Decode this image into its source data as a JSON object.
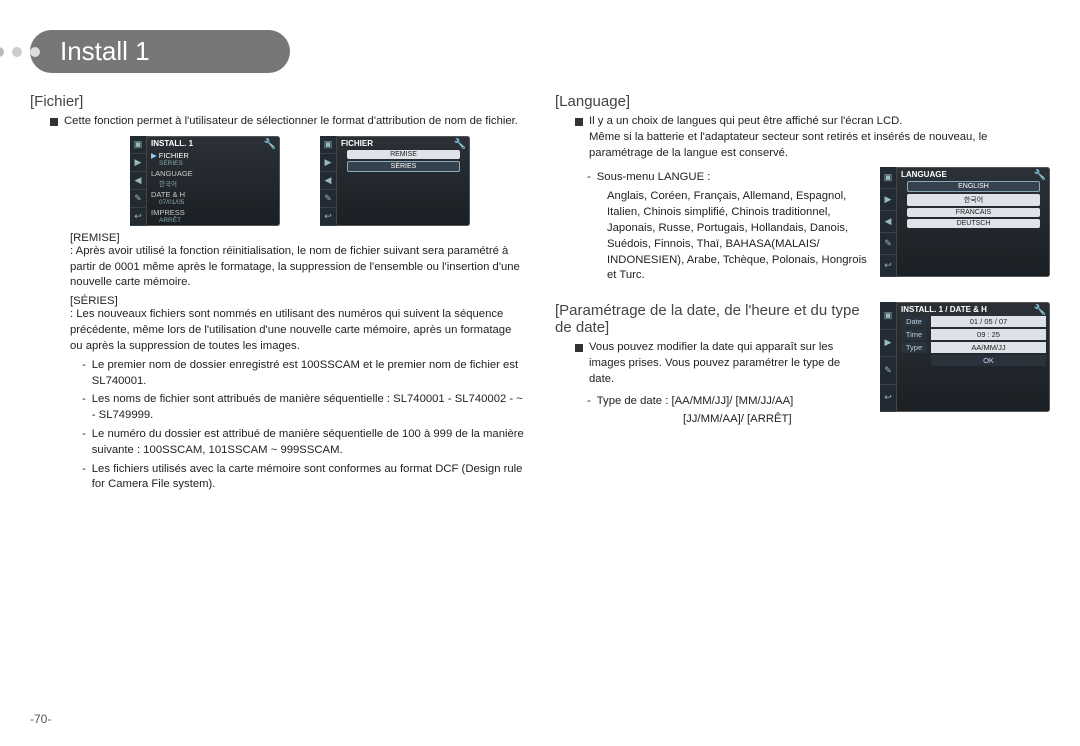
{
  "page_number": "-70-",
  "title": "Install 1",
  "left": {
    "heading": "[Fichier]",
    "intro": "Cette fonction permet à l'utilisateur de sélectionner le format d'attribution de nom de fichier.",
    "lcd1": {
      "header": "INSTALL. 1",
      "rows": [
        {
          "label": "FICHIER",
          "sub": "SÉRIES",
          "sel": true
        },
        {
          "label": "LANGUAGE",
          "sub": "한국어"
        },
        {
          "label": "DATE & H",
          "sub": "07/01/05"
        },
        {
          "label": "IMPRESS",
          "sub": "ARRÊT"
        }
      ]
    },
    "lcd2": {
      "header": "FICHIER",
      "pills": [
        "REMISE",
        "SÉRIES"
      ],
      "selected": 1
    },
    "remise_label": "[REMISE]",
    "remise_text": ": Après avoir utilisé la fonction réinitialisation, le nom de fichier suivant sera paramétré à partir de 0001 même après le formatage, la suppression de l'ensemble ou l'insertion d'une nouvelle carte mémoire.",
    "series_label": "[SÉRIES]",
    "series_text": ": Les nouveaux fichiers sont nommés en utilisant des numéros qui suivent la séquence précédente, même lors de l'utilisation d'une nouvelle carte mémoire, après un formatage ou après la suppression de toutes les images.",
    "bullets": [
      "Le premier nom de dossier enregistré est 100SSCAM et le premier nom de fichier est SL740001.",
      "Les noms de fichier sont attribués de manière séquentielle : SL740001 - SL740002 - ~ - SL749999.",
      "Le numéro du dossier est attribué de manière séquentielle de 100 à 999 de la manière suivante : 100SSCAM, 101SSCAM ~ 999SSCAM.",
      "Les fichiers utilisés avec la carte mémoire sont conformes au format DCF (Design rule for Camera File system)."
    ]
  },
  "right": {
    "lang_heading": "[Language]",
    "lang_intro": "Il y a un choix de langues qui peut être affiché sur l'écran LCD.",
    "lang_note": "Même si la batterie et l'adaptateur secteur sont retirés et insérés de nouveau, le paramétrage de la langue est conservé.",
    "lang_sub_label": "Sous-menu LANGUE :",
    "lang_list": "Anglais, Coréen, Français, Allemand, Espagnol, Italien, Chinois simplifié, Chinois traditionnel, Japonais, Russe, Portugais, Hollandais, Danois, Suédois, Finnois, Thaï, BAHASA(MALAIS/ INDONESIEN), Arabe, Tchèque, Polonais, Hongrois et Turc.",
    "lang_lcd": {
      "header": "LANGUAGE",
      "pills": [
        "ENGLISH",
        "한국어",
        "FRANCAIS",
        "DEUTSCH"
      ],
      "selected": 0
    },
    "date_heading": "[Paramétrage de la date, de l'heure et du type de date]",
    "date_intro": "Vous pouvez modifier la date qui apparaît sur les images prises. Vous pouvez paramétrer le type de date.",
    "date_type_label": "Type de date : [AA/MM/JJ]/ [MM/JJ/AA]",
    "date_type_label2": "[JJ/MM/AA]/ [ARRÊT]",
    "date_lcd": {
      "header": "INSTALL. 1  /  DATE & H",
      "date_label": "Date",
      "date_value": "01  /  05  /  07",
      "time_label": "Time",
      "time_value": "09  :  25",
      "type_label": "Type",
      "type_value": "AA/MM/JJ",
      "ok": "OK"
    }
  }
}
